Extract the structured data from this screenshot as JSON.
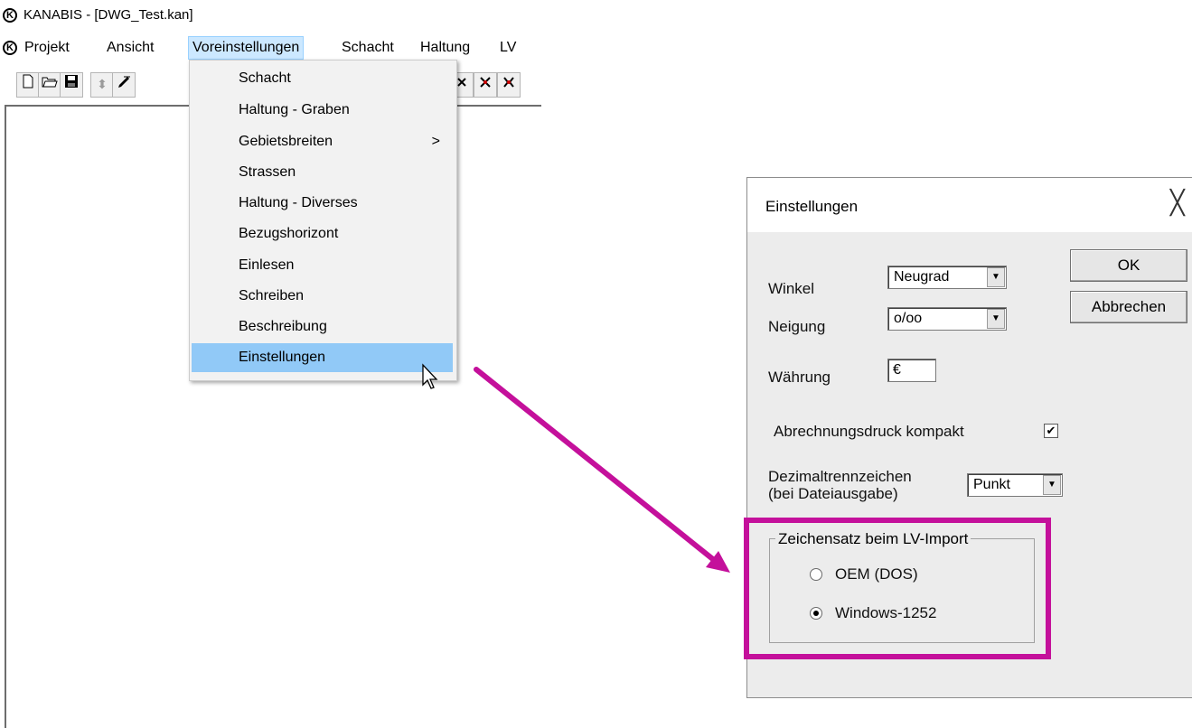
{
  "window": {
    "title": "KANABIS - [DWG_Test.kan]",
    "logo_letter": "K"
  },
  "menubar": {
    "items": [
      "Projekt",
      "Ansicht",
      "Voreinstellungen",
      "Schacht",
      "Haltung",
      "LV"
    ],
    "active": "Voreinstellungen"
  },
  "toolbar": {
    "icons": [
      "new-file-icon",
      "open-folder-icon",
      "save-disk-icon",
      "move-updown-icon",
      "pen-icon",
      "node-icon",
      "node-cross-icon",
      "node-link-icon"
    ]
  },
  "dropdown": {
    "items": [
      {
        "label": "Schacht"
      },
      {
        "label": "Haltung - Graben"
      },
      {
        "label": "Gebietsbreiten",
        "submenu": true,
        "submenu_arrow": ">"
      },
      {
        "label": "Strassen"
      },
      {
        "label": "Haltung - Diverses"
      },
      {
        "label": "Bezugshorizont"
      },
      {
        "label": "Einlesen"
      },
      {
        "label": "Schreiben"
      },
      {
        "label": "Beschreibung"
      },
      {
        "label": "Einstellungen",
        "highlighted": true
      }
    ]
  },
  "dialog": {
    "title": "Einstellungen",
    "close_glyph": "╳",
    "ok_label": "OK",
    "cancel_label": "Abbrechen",
    "winkel": {
      "label": "Winkel",
      "value": "Neugrad"
    },
    "neigung": {
      "label": "Neigung",
      "value": "o/oo"
    },
    "waehrung": {
      "label": "Währung",
      "value": "€"
    },
    "abrechnung": {
      "label": "Abrechnungsdruck kompakt",
      "checked": true,
      "check_glyph": "✔"
    },
    "dezimal": {
      "label_line1": "Dezimaltrennzeichen",
      "label_line2": "(bei Dateiausgabe)",
      "value": "Punkt"
    },
    "zeichensatz": {
      "legend": "Zeichensatz beim LV-Import",
      "options": [
        {
          "label": "OEM (DOS)",
          "selected": false
        },
        {
          "label": "Windows-1252",
          "selected": true
        }
      ]
    }
  },
  "annotation": {
    "arrow_color": "#c4109b",
    "highlight_color": "#c4109b"
  }
}
